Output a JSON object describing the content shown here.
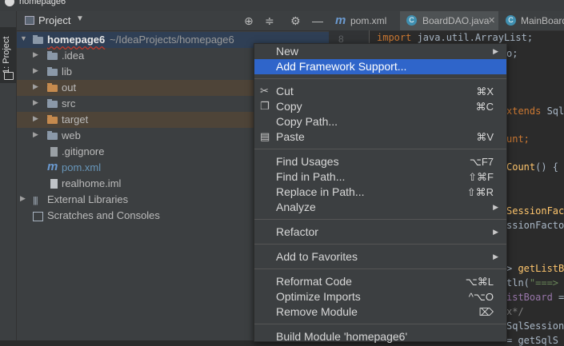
{
  "window": {
    "title": "homepage6"
  },
  "side_strip": {
    "project_tab": "1: Project"
  },
  "panel": {
    "title": "Project",
    "tree": [
      {
        "label": "homepage6",
        "path": "~/IdeaProjects/homepage6"
      },
      {
        "label": ".idea"
      },
      {
        "label": "lib"
      },
      {
        "label": "out"
      },
      {
        "label": "src"
      },
      {
        "label": "target"
      },
      {
        "label": "web"
      },
      {
        "label": ".gitignore"
      },
      {
        "label": "pom.xml"
      },
      {
        "label": "realhome.iml"
      },
      {
        "label": "External Libraries"
      },
      {
        "label": "Scratches and Consoles"
      }
    ]
  },
  "editor": {
    "tabs": [
      {
        "label": "pom.xml"
      },
      {
        "label": "BoardDAO.java"
      },
      {
        "label": "MainBoard"
      }
    ],
    "gutter_line": "8",
    "code": {
      "l1a": "import",
      "l1b": " java.util.ArrayList;",
      "l2": "o;",
      "l3a": "xtends",
      "l3b": " SqlS",
      "l4": "unt;",
      "l5a": "Count",
      "l5b": "() { r",
      "l6": "SessionFacto",
      "l7": "ssionFactory",
      "l8a": "> ",
      "l8b": "getListBo",
      "l9a": "tln(",
      "l9b": "\"===> M",
      "l10a": "istBoard",
      "l10b": " =",
      "l11": "x*/",
      "l12": "SqlSession(",
      "l13": "= getSqlS"
    }
  },
  "context_menu": {
    "items": [
      {
        "label": "New"
      },
      {
        "label": "Add Framework Support..."
      },
      {
        "label": "Cut",
        "shortcut": "⌘X"
      },
      {
        "label": "Copy",
        "shortcut": "⌘C"
      },
      {
        "label": "Copy Path..."
      },
      {
        "label": "Paste",
        "shortcut": "⌘V"
      },
      {
        "label": "Find Usages",
        "shortcut": "⌥F7"
      },
      {
        "label": "Find in Path...",
        "shortcut": "⇧⌘F"
      },
      {
        "label": "Replace in Path...",
        "shortcut": "⇧⌘R"
      },
      {
        "label": "Analyze"
      },
      {
        "label": "Refactor"
      },
      {
        "label": "Add to Favorites"
      },
      {
        "label": "Reformat Code",
        "shortcut": "⌥⌘L"
      },
      {
        "label": "Optimize Imports",
        "shortcut": "^⌥O"
      },
      {
        "label": "Remove Module",
        "shortcut": "⌦"
      },
      {
        "label": "Build Module 'homepage6'"
      }
    ]
  }
}
